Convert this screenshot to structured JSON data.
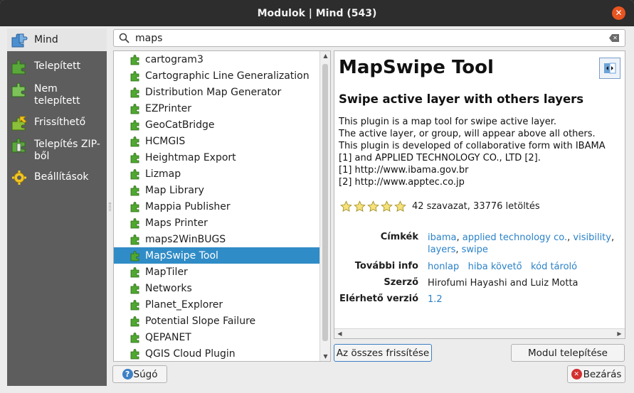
{
  "window": {
    "title": "Modulok | Mind (543)",
    "close_symbol": "✕"
  },
  "sidebar": {
    "items": [
      {
        "label": "Mind",
        "icon": "puzzle-blue-icon",
        "active": true
      },
      {
        "label": "Telepített",
        "icon": "installed-plugin-icon"
      },
      {
        "label": "Nem telepített",
        "icon": "not-installed-plugin-icon"
      },
      {
        "label": "Frissíthető",
        "icon": "upgradeable-plugin-icon"
      },
      {
        "label": "Telepítés ZIP-ből",
        "icon": "install-zip-icon"
      },
      {
        "label": "Beállítások",
        "icon": "settings-gear-icon"
      }
    ]
  },
  "search": {
    "value": "maps",
    "placeholder": ""
  },
  "plugin_list": [
    "cartogram3",
    "Cartographic Line Generalization",
    "Distribution Map Generator",
    "EZPrinter",
    "GeoCatBridge",
    "HCMGIS",
    "Heightmap Export",
    "Lizmap",
    "Map Library",
    "Mappia Publisher",
    "Maps Printer",
    "maps2WinBUGS",
    "MapSwipe Tool",
    "MapTiler",
    "Networks",
    "Planet_Explorer",
    "Potential Slope Failure",
    "QEPANET",
    "QGIS Cloud Plugin"
  ],
  "selected_plugin": "MapSwipe Tool",
  "details": {
    "title": "MapSwipe Tool",
    "subtitle": "Swipe active layer with others layers",
    "description": [
      "This plugin is a map tool for swipe active layer.",
      "The active layer, or group, will appear above all others.",
      "This plugin is developed of collaborative form with IBAMA",
      "[1] and APPLIED TECHNOLOGY CO., LTD [2].",
      "[1] http://www.ibama.gov.br",
      "[2] http://www.apptec.co.jp"
    ],
    "rating_stars": 5,
    "votes_text": "42 szavazat, 33776 letöltés",
    "tags_label": "Címkék",
    "tags_line1": [
      "ibama",
      "applied technology co.",
      "visibility"
    ],
    "tags_line2": [
      "layers",
      "swipe"
    ],
    "more_info_label": "További info",
    "more_info_links": [
      "honlap",
      "hiba követő",
      "kód tároló"
    ],
    "author_label": "Szerző",
    "author": "Hirofumi Hayashi and Luiz Motta",
    "version_label": "Elérhető verzió",
    "version": "1.2"
  },
  "buttons": {
    "upgrade_all": "Az összes frissítése",
    "install": "Modul telepítése",
    "help": "Súgó",
    "close": "Bezárás"
  },
  "colors": {
    "selection": "#308cc6",
    "link": "#2a82c8",
    "sidebar_bg": "#5d5d5d",
    "titlebar_bg": "#2d2d2d",
    "close_button": "#e95420"
  }
}
